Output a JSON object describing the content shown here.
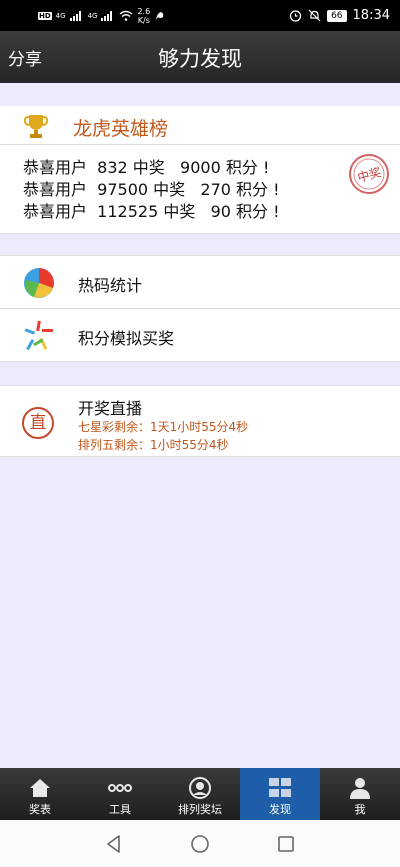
{
  "status_bar": {
    "network_left": "4G",
    "network_right": "4G",
    "speed_value": "2.6",
    "speed_unit": "K/s",
    "battery": "66",
    "time": "18:34"
  },
  "header": {
    "share_label": "分享",
    "title": "够力发现"
  },
  "hero": {
    "title": "龙虎英雄榜",
    "stamp_text": "中奖",
    "lines": [
      "恭喜用户  832 中奖   9000 积分 !",
      "恭喜用户  97500 中奖   270 积分 !",
      "恭喜用户  112525 中奖   90 积分 !"
    ]
  },
  "menu": {
    "hot_stats": "热码统计",
    "points_sim": "积分模拟买奖"
  },
  "live": {
    "icon_char": "直",
    "title": "开奖直播",
    "lines": [
      "七星彩剩余：1天1小时55分4秒",
      "排列五剩余：1小时55分4秒"
    ]
  },
  "tabs": [
    {
      "label": "奖表"
    },
    {
      "label": "工具"
    },
    {
      "label": "排列奖坛"
    },
    {
      "label": "发现",
      "active": true
    },
    {
      "label": "我"
    }
  ],
  "colors": {
    "accent_orange": "#c35a1d",
    "tab_active": "#1e5ea8",
    "page_bg": "#ecebfb"
  }
}
